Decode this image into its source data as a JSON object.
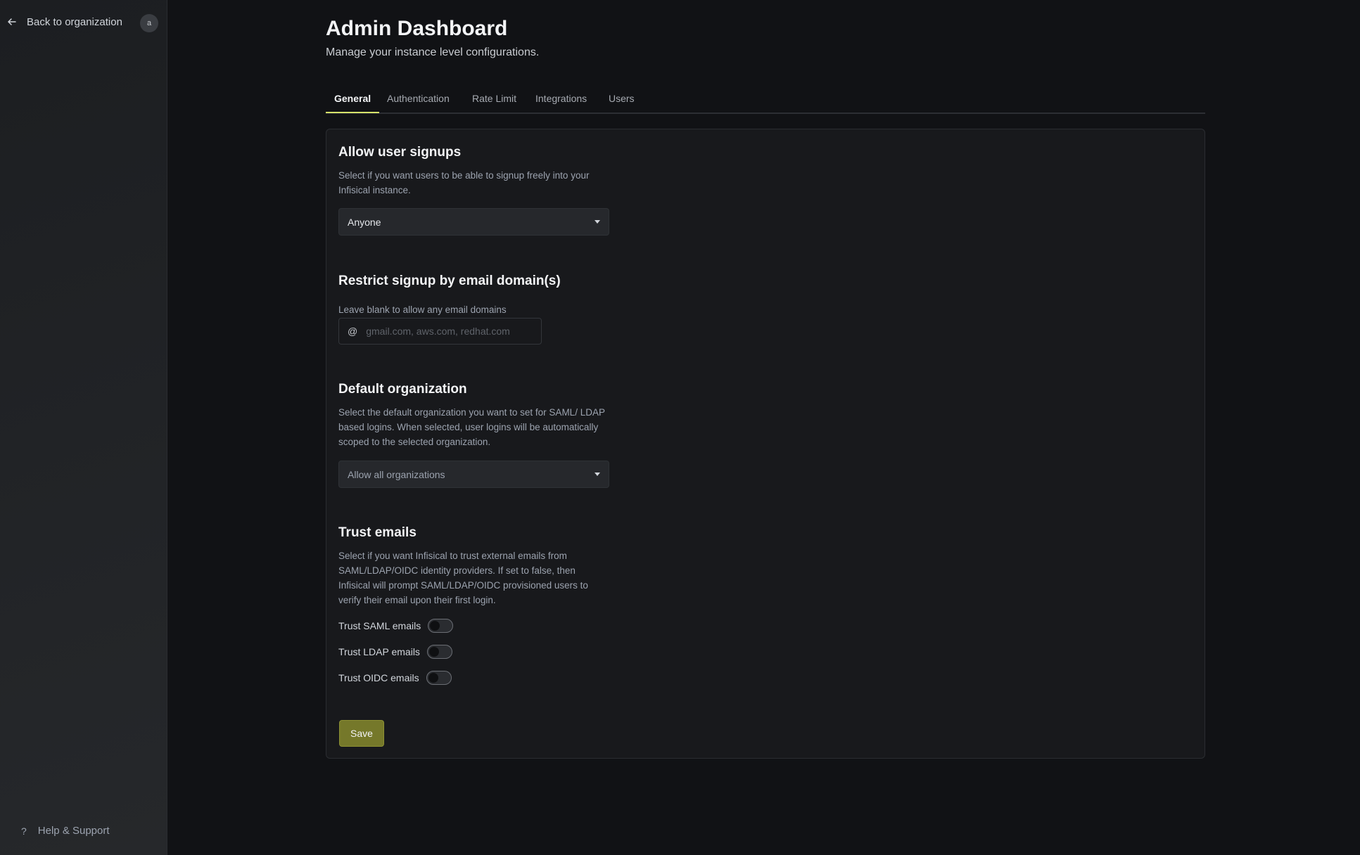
{
  "sidebar": {
    "back_label": "Back to organization",
    "avatar_initial": "a",
    "help_label": "Help & Support",
    "help_glyph": "?"
  },
  "header": {
    "title": "Admin Dashboard",
    "subtitle": "Manage your instance level configurations."
  },
  "tabs": [
    {
      "label": "General",
      "active": true
    },
    {
      "label": "Authentication",
      "active": false
    },
    {
      "label": "Rate Limit",
      "active": false
    },
    {
      "label": "Integrations",
      "active": false
    },
    {
      "label": "Users",
      "active": false
    }
  ],
  "sections": {
    "signups": {
      "title": "Allow user signups",
      "description": "Select if you want users to be able to signup freely into your Infisical instance.",
      "selected": "Anyone"
    },
    "restrict": {
      "title": "Restrict signup by email domain(s)",
      "hint": "Leave blank to allow any email domains",
      "at_symbol": "@",
      "placeholder": "gmail.com, aws.com, redhat.com",
      "value": ""
    },
    "default_org": {
      "title": "Default organization",
      "description": "Select the default organization you want to set for SAML/ LDAP based logins. When selected, user logins will be automatically scoped to the selected organization.",
      "selected": "Allow all organizations"
    },
    "trust": {
      "title": "Trust emails",
      "description": "Select if you want Infisical to trust external emails from SAML/LDAP/OIDC identity providers. If set to false, then Infisical will prompt SAML/LDAP/OIDC provisioned users to verify their email upon their first login.",
      "toggles": [
        {
          "label": "Trust SAML emails",
          "on": false
        },
        {
          "label": "Trust LDAP emails",
          "on": false
        },
        {
          "label": "Trust OIDC emails",
          "on": false
        }
      ]
    }
  },
  "save_label": "Save",
  "colors": {
    "accent": "#d6e36a",
    "save_button": "#75782a"
  },
  "icons": {
    "back": "arrow-left-icon",
    "help": "question-icon",
    "dropdown": "caret-down-icon"
  }
}
